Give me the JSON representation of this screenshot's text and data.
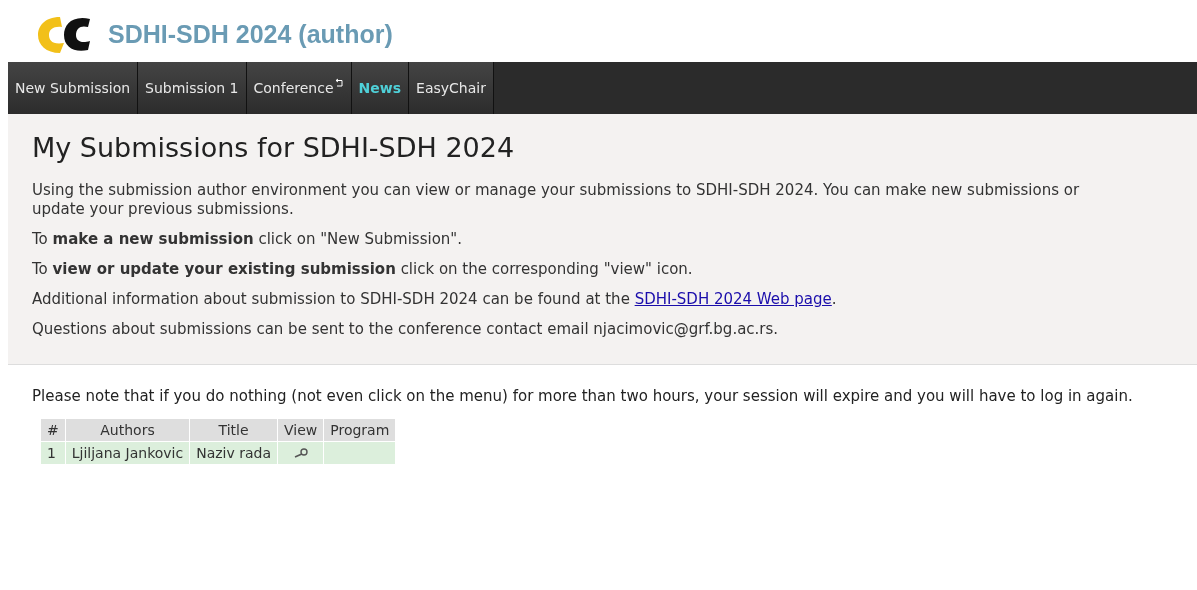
{
  "header": {
    "title": "SDHI-SDH 2024 (author)"
  },
  "menu": [
    {
      "label": "New Submission",
      "selected": false,
      "external": false
    },
    {
      "label": "Submission 1",
      "selected": false,
      "external": false
    },
    {
      "label": "Conference",
      "selected": false,
      "external": true
    },
    {
      "label": "News",
      "selected": true,
      "external": false
    },
    {
      "label": "EasyChair",
      "selected": false,
      "external": false
    }
  ],
  "panel": {
    "heading": "My Submissions for SDHI-SDH 2024",
    "paragraphs": [
      {
        "text": "Using the submission author environment you can view or manage your submissions to SDHI-SDH 2024. You can make new submissions or update your previous submissions."
      },
      {
        "text": "To **make a new submission** click on \"New Submission\"."
      },
      {
        "text": "To **view or update your existing submission** click on the corresponding \"view\" icon."
      },
      {
        "text": "Additional information about submission to SDHI-SDH 2024 can be found at the ",
        "link": "SDHI-SDH 2024 Web page",
        "after": "."
      },
      {
        "text": "Questions about submissions can be sent to the conference contact email njacimovic@grf.bg.ac.rs."
      }
    ]
  },
  "notice": "Please note that if you do nothing (not even click on the menu) for more than two hours, your session will expire and you will have to log in again.",
  "table": {
    "columns": [
      "#",
      "Authors",
      "Title",
      "View",
      "Program"
    ],
    "rows": [
      {
        "number": "1",
        "authors": "Ljiljana Jankovic",
        "title": "Naziv rada"
      }
    ]
  }
}
